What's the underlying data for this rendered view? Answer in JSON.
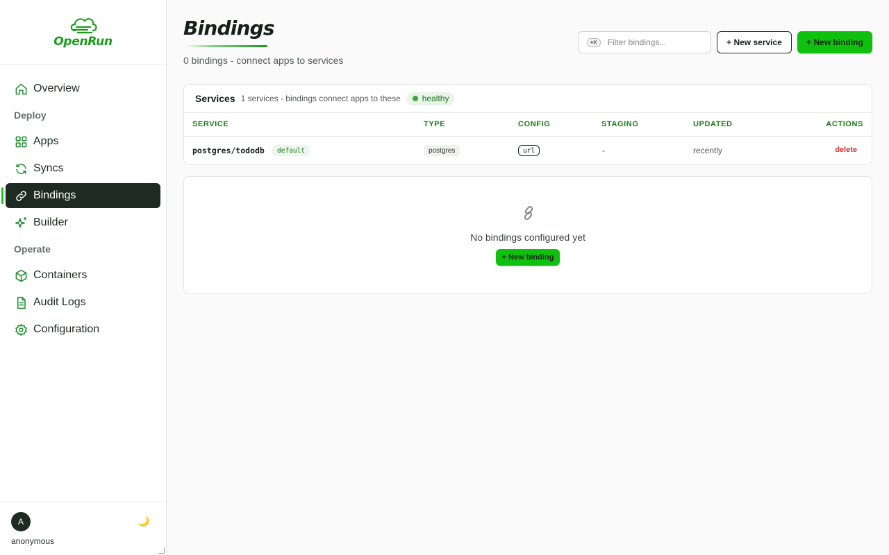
{
  "brand": {
    "name": "OpenRun"
  },
  "sidebar": {
    "items": [
      {
        "label": "Overview",
        "icon": "home-icon"
      },
      {
        "section": "Deploy"
      },
      {
        "label": "Apps",
        "icon": "grid-icon"
      },
      {
        "label": "Syncs",
        "icon": "refresh-icon"
      },
      {
        "label": "Bindings",
        "icon": "link-icon",
        "active": true
      },
      {
        "label": "Builder",
        "icon": "sparkle-icon"
      },
      {
        "section": "Operate"
      },
      {
        "label": "Containers",
        "icon": "box-icon"
      },
      {
        "label": "Audit Logs",
        "icon": "document-icon"
      },
      {
        "label": "Configuration",
        "icon": "gear-icon"
      }
    ]
  },
  "user": {
    "initial": "A",
    "name": "anonymous",
    "theme_icon": "🌙"
  },
  "header": {
    "title": "Bindings",
    "subtitle": "0 bindings - connect apps to services",
    "filter_shortcut": "⌘K",
    "filter_placeholder": "Filter bindings...",
    "new_service_label": "+ New service",
    "new_binding_label": "+ New binding"
  },
  "services": {
    "title": "Services",
    "subtitle": "1 services - bindings connect apps to these",
    "health": "healthy",
    "columns": [
      "SERVICE",
      "TYPE",
      "CONFIG",
      "STAGING",
      "UPDATED",
      "ACTIONS"
    ],
    "rows": [
      {
        "service": "postgres/tododb",
        "tag": "default",
        "type": "postgres",
        "config": "url",
        "staging": "-",
        "updated": "recently",
        "action": "delete"
      }
    ]
  },
  "empty": {
    "icon": "🔗",
    "text": "No bindings configured yet",
    "button_label": "+ New binding"
  },
  "colors": {
    "accent": "#0fc00f",
    "sidebar_active_bg": "#1e2b22",
    "danger": "#d32f2f",
    "header_green": "#1a7a1a"
  }
}
